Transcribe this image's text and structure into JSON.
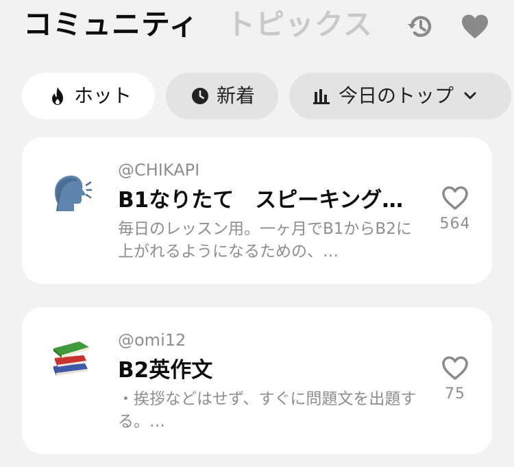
{
  "header": {
    "tabs": [
      {
        "label": "コミュニティ",
        "active": true
      },
      {
        "label": "トピックス",
        "active": false
      }
    ],
    "icons": [
      "history-icon",
      "heart-icon"
    ]
  },
  "filters": {
    "hot": {
      "label": "ホット",
      "icon": "flame-icon",
      "selected": true
    },
    "new": {
      "label": "新着",
      "icon": "clock-icon",
      "selected": false
    },
    "top": {
      "label": "今日のトップ",
      "icon": "bar-chart-icon",
      "dropdown": true
    }
  },
  "posts": [
    {
      "author": "@CHIKAPI",
      "title": "B1なりたて　スピーキング…",
      "description": "毎日のレッスン用。一ヶ月でB1からB2に上がれるようになるための、…",
      "likes": "564",
      "icon": "speaking-head-icon"
    },
    {
      "author": "@omi12",
      "title": "B2英作文",
      "description": "・挨拶などはせず、すぐに問題文を出題する。…",
      "likes": "75",
      "icon": "books-icon"
    }
  ],
  "colors": {
    "background": "#f2f2f2",
    "card": "#ffffff",
    "chip_inactive": "#e3e3e3",
    "muted_text": "#8e8e8e",
    "inactive_tab": "#c9c9c9",
    "icon_gray": "#8a8a8a"
  }
}
